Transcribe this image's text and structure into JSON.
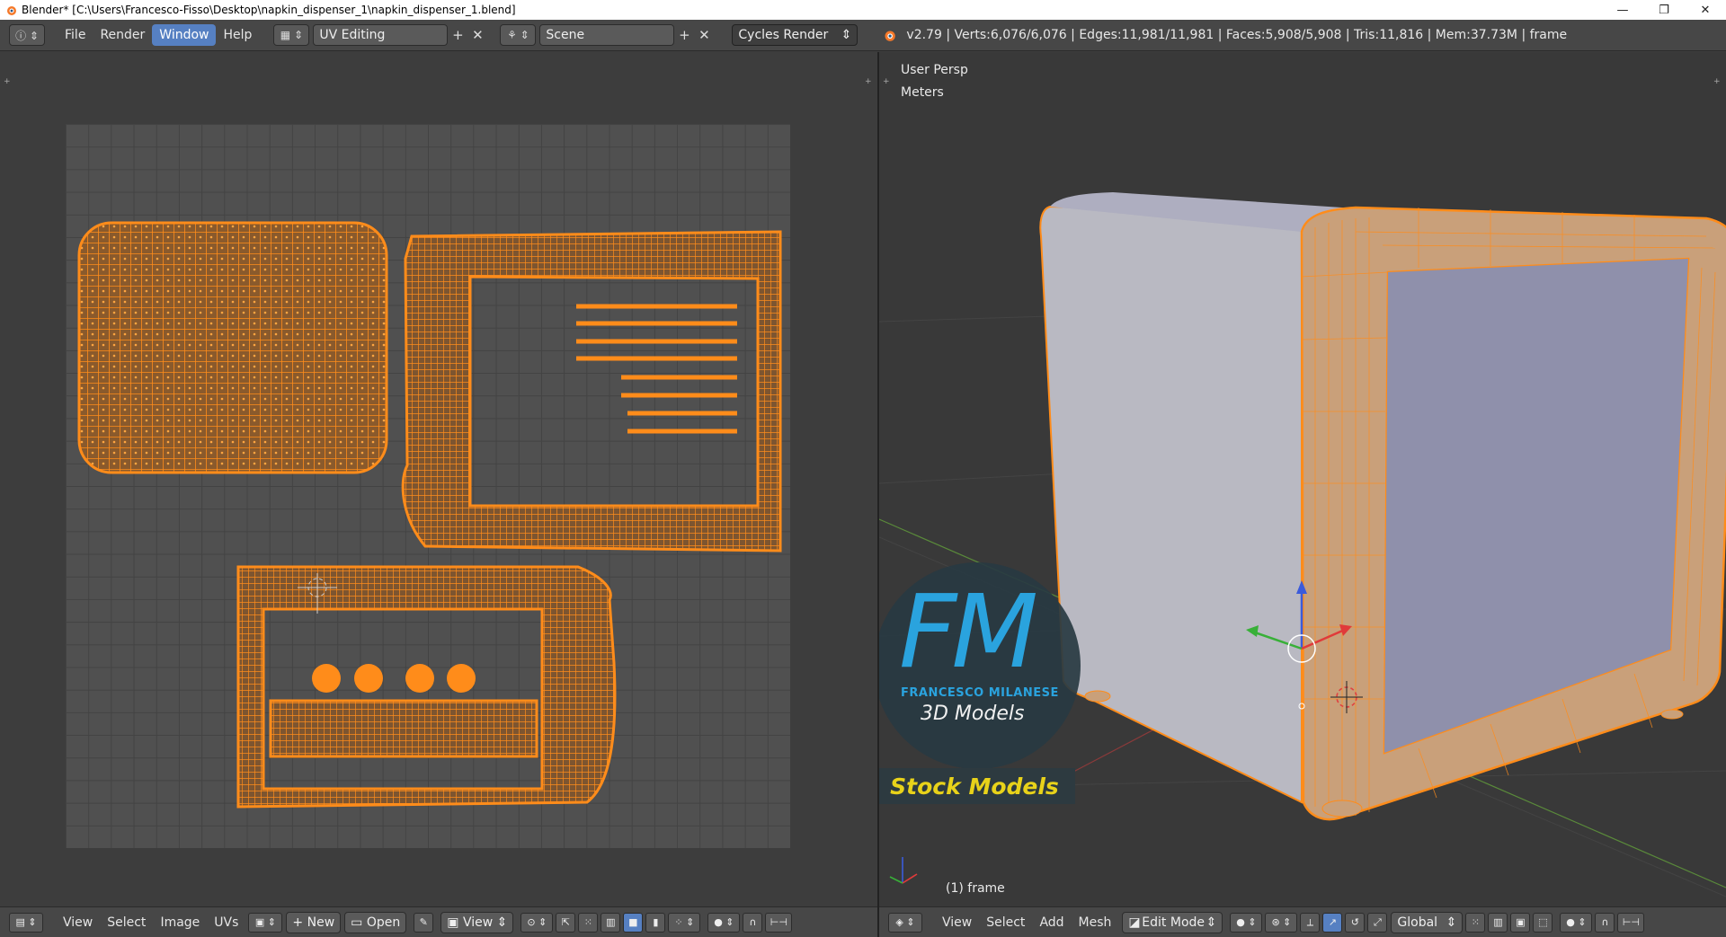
{
  "window": {
    "title": "Blender* [C:\\Users\\Francesco-Fisso\\Desktop\\napkin_dispenser_1\\napkin_dispenser_1.blend]",
    "minimize": "—",
    "restore": "❐",
    "close": "✕"
  },
  "info_header": {
    "menus": [
      "File",
      "Render",
      "Window",
      "Help"
    ],
    "active_menu": "Window",
    "layout_name": "UV Editing",
    "scene_name": "Scene",
    "render_engine": "Cycles Render",
    "stats": "v2.79 | Verts:6,076/6,076 | Edges:11,981/11,981 | Faces:5,908/5,908 | Tris:11,816 | Mem:37.73M | frame"
  },
  "uv_editor": {
    "menus": [
      "View",
      "Select",
      "Image",
      "UVs"
    ],
    "new_label": "New",
    "open_label": "Open",
    "view_label": "View"
  },
  "viewport": {
    "view_name": "User Persp",
    "units": "Meters",
    "object_label": "(1) frame",
    "menus": [
      "View",
      "Select",
      "Add",
      "Mesh"
    ],
    "mode": "Edit Mode",
    "orientation": "Global"
  },
  "watermark": {
    "logo_letters": "FM",
    "brand_name": "FRANCESCO MILANESE",
    "tagline": "3D Models",
    "banner": "Stock Models"
  },
  "colors": {
    "accent": "#5680c2",
    "uv_orange": "#ff8c1a",
    "mesh_gray": "#b8b8c4"
  }
}
